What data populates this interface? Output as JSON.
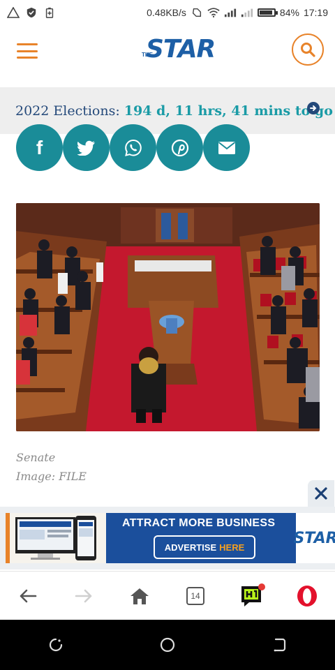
{
  "status_bar": {
    "speed": "0.48KB/s",
    "battery": "84%",
    "battery_fraction": 0.84,
    "time": "17:19"
  },
  "header": {
    "logo_the": "THE",
    "logo_text": "STAR"
  },
  "countdown": {
    "label": "2022 Elections:",
    "value": "194 d, 11 hrs, 41 mins to go"
  },
  "share": {
    "facebook": "f"
  },
  "article": {
    "caption_line1": "Senate",
    "caption_line2": "Image: FILE"
  },
  "ad": {
    "title": "ATTRACT MORE BUSINESS",
    "cta_main": "ADVERTISE",
    "cta_highlight": "HERE",
    "brand": "STAR"
  },
  "browser_nav": {
    "tab_count": "14"
  },
  "colors": {
    "accent_orange": "#e8832a",
    "brand_blue": "#1d5fa6",
    "teal": "#1a8c98",
    "countdown_value": "#1a9ba6"
  }
}
